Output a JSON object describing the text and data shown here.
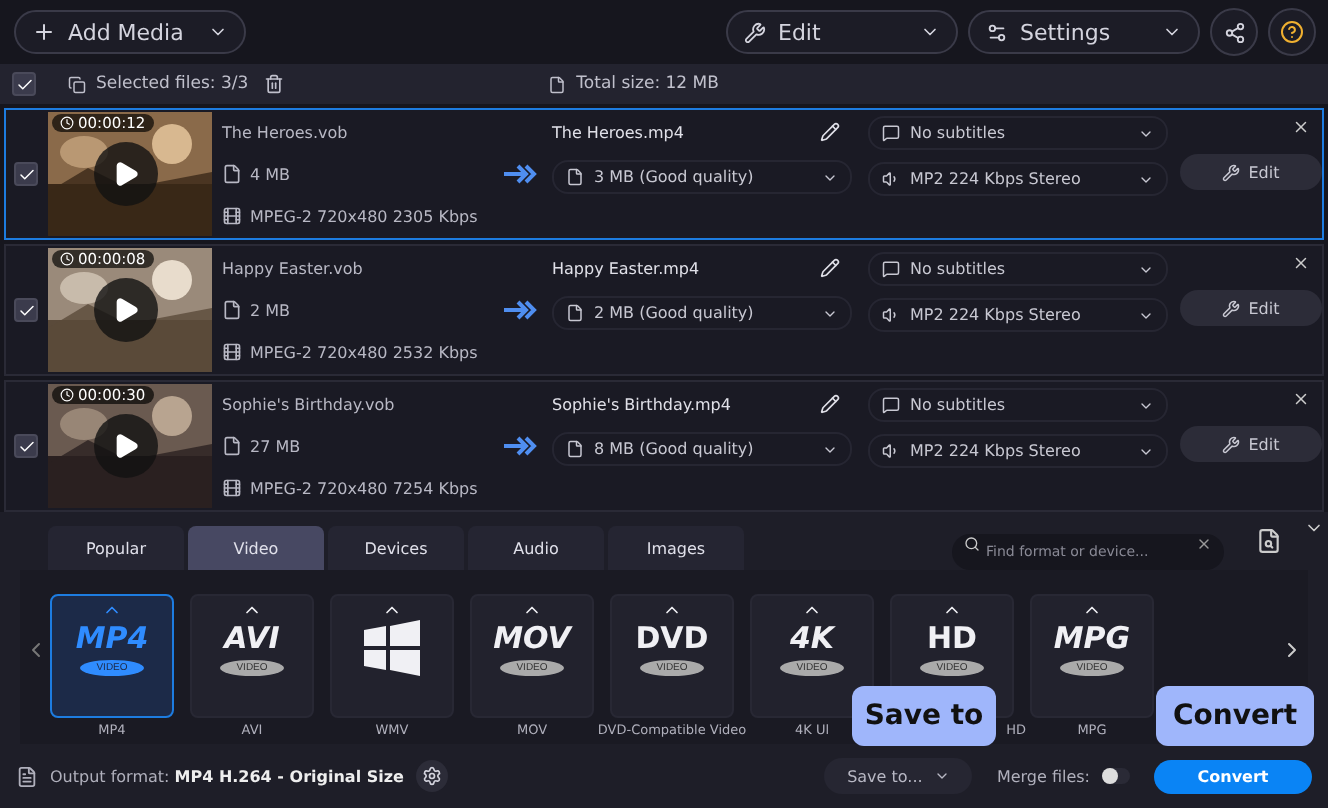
{
  "toolbar": {
    "add_media": "Add Media",
    "edit": "Edit",
    "settings": "Settings"
  },
  "selection_bar": {
    "checked": true,
    "selected_files": "Selected files: 3/3",
    "total_size": "Total size: 12 MB"
  },
  "files": [
    {
      "selected": true,
      "checked": true,
      "duration": "00:00:12",
      "source": "The Heroes.vob",
      "size": "4 MB",
      "codec": "MPEG-2 720x480 2305 Kbps",
      "output": "The Heroes.mp4",
      "output_size": "3 MB (Good quality)",
      "subtitles": "No subtitles",
      "audio": "MP2 224 Kbps Stereo",
      "edit": "Edit"
    },
    {
      "selected": false,
      "checked": true,
      "duration": "00:00:08",
      "source": "Happy Easter.vob",
      "size": "2 MB",
      "codec": "MPEG-2 720x480 2532 Kbps",
      "output": "Happy Easter.mp4",
      "output_size": "2 MB (Good quality)",
      "subtitles": "No subtitles",
      "audio": "MP2 224 Kbps Stereo",
      "edit": "Edit"
    },
    {
      "selected": false,
      "checked": true,
      "duration": "00:00:30",
      "source": "Sophie's Birthday.vob",
      "size": "27 MB",
      "codec": "MPEG-2 720x480 7254 Kbps",
      "output": "Sophie's Birthday.mp4",
      "output_size": "8 MB (Good quality)",
      "subtitles": "No subtitles",
      "audio": "MP2 224 Kbps Stereo",
      "edit": "Edit"
    }
  ],
  "tabs": [
    {
      "label": "Popular",
      "selected": false
    },
    {
      "label": "Video",
      "selected": true
    },
    {
      "label": "Devices",
      "selected": false
    },
    {
      "label": "Audio",
      "selected": false
    },
    {
      "label": "Images",
      "selected": false
    }
  ],
  "search": {
    "placeholder": "Find format or device..."
  },
  "formats": [
    {
      "kind": "logo",
      "logo": "MP4",
      "sub": "VIDEO",
      "label": "MP4",
      "selected": true
    },
    {
      "kind": "logo",
      "logo": "AVI",
      "sub": "VIDEO",
      "label": "AVI",
      "selected": false
    },
    {
      "kind": "windows",
      "label": "WMV",
      "selected": false
    },
    {
      "kind": "logo",
      "logo": "MOV",
      "sub": "VIDEO",
      "label": "MOV",
      "selected": false
    },
    {
      "kind": "disc",
      "logo": "DVD",
      "sub": "VIDEO",
      "label": "DVD-Compatible Video",
      "selected": false
    },
    {
      "kind": "logo",
      "logo": "4K",
      "sub": "VIDEO",
      "label": "4K Ul",
      "selected": false
    },
    {
      "kind": "disc",
      "logo": "HD",
      "sub": "VIDEO",
      "label": "HD",
      "selected": false
    },
    {
      "kind": "logo",
      "logo": "MPG",
      "sub": "VIDEO",
      "label": "MPG",
      "selected": false
    }
  ],
  "bottom": {
    "output_label": "Output format:",
    "output_value": "MP4 H.264 - Original Size",
    "save_to": "Save to...",
    "merge_label": "Merge files:",
    "merge_on": false,
    "convert": "Convert"
  },
  "tooltips": [
    "Save to",
    "Convert"
  ]
}
